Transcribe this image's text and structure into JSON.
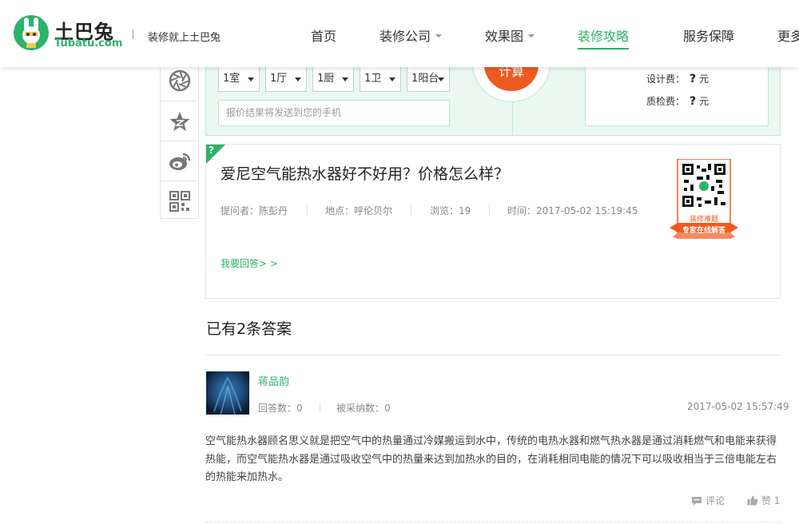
{
  "brand": {
    "name_cn": "土巴兔",
    "name_en": "Tubatu.com",
    "slogan": "装修就上土巴兔",
    "accent": "#2db36a"
  },
  "nav": [
    {
      "label": "首页"
    },
    {
      "label": "装修公司"
    },
    {
      "label": "效果图"
    },
    {
      "label": "装修攻略"
    },
    {
      "label": "服务保障"
    },
    {
      "label": "更多"
    }
  ],
  "sidebar": {
    "icons": [
      "camera-shutter-icon",
      "star-icon",
      "weibo-icon",
      "qr-code-icon"
    ]
  },
  "calculator": {
    "selects": [
      "1室",
      "1厅",
      "1厨",
      "1卫",
      "1阳台"
    ],
    "phone_placeholder": "报价结果将发送到您的手机",
    "button": "计算",
    "fees": [
      {
        "label": "设计费：",
        "value": "?",
        "unit": "元"
      },
      {
        "label": "质检费：",
        "value": "?",
        "unit": "元"
      }
    ]
  },
  "question": {
    "badge": "?",
    "title": "爱尼空气能热水器好不好用？价格怎么样？",
    "asker": "提问者：陈彭丹",
    "location": "地点：呼伦贝尔",
    "views": "浏览：19",
    "time": "时间：2017-05-02 15:19:45",
    "answer_link": "我要回答> >",
    "qr_caption_1": "装修难题",
    "qr_caption_2": "专家在线解答"
  },
  "answers": {
    "heading": "已有2条答案",
    "items": [
      {
        "user": "蒋品韵",
        "answer_count": "回答数：0",
        "adopted_count": "被采纳数：0",
        "time": "2017-05-02 15:57:49",
        "text": "空气能热水器顾名思义就是把空气中的热量通过冷媒搬运到水中，传统的电热水器和燃气热水器是通过消耗燃气和电能来获得热能，而空气能热水器是通过吸收空气中的热量来达到加热水的目的，在消耗相同电能的情况下可以吸收相当于三倍电能左右的热能来加热水。",
        "comment": "评论",
        "like": "赞 1"
      }
    ]
  }
}
